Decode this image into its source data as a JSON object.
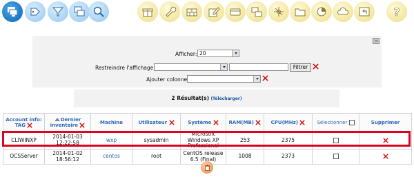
{
  "toolbar": {
    "left_icons": [
      "computers-icon",
      "tag-icon",
      "filter-funnel-icon",
      "windows-icon",
      "search-icon"
    ],
    "right_icons": [
      "gift-icon",
      "wrench-icon",
      "firewall-icon",
      "edit-icon",
      "card-icon",
      "network-icon",
      "network-tree-icon",
      "folder-icon",
      "chart-icon",
      "cloud-icon",
      "back-icon",
      "help-icon"
    ]
  },
  "filters": {
    "display_label": "Afficher:",
    "display_value": "20",
    "restrict_label": "Restreindre l'affichage:",
    "restrict_value": "",
    "restrict_text": "",
    "filter_button": "Filtrer",
    "add_column_label": "Ajouter colonne:",
    "add_column_value": ""
  },
  "results": {
    "count_text": "2 Résultat(s)",
    "download_link": "(Télécharger)"
  },
  "table": {
    "columns": {
      "account": "Account info: TAG",
      "last_inventory": "Dernier inventaire",
      "machine": "Machine",
      "user": "Utilisateur",
      "os": "Système",
      "ram": "RAM(MB)",
      "cpu": "CPU(MHz)",
      "select": "Sélectionner",
      "delete": "Supprimer"
    },
    "rows": [
      {
        "account": "CLIWINXP",
        "last_inventory": "2014-01-03 12:22:58",
        "machine": "wxp",
        "user": "sysadmin",
        "os": "Microsoft Windows XP Professional",
        "ram": "253",
        "cpu": "2375"
      },
      {
        "account": "OCSServer",
        "last_inventory": "2014-01-02 18:56:12",
        "machine": "centos",
        "user": "root",
        "os": "CentOS release 6.5 (Final)",
        "ram": "1008",
        "cpu": "2373"
      }
    ]
  },
  "colors": {
    "accent": "#2a67b5",
    "highlight": "#e0001b",
    "toolbar_yellow": "#f3e69f",
    "toolbar_blue": "#a9d3f2"
  }
}
